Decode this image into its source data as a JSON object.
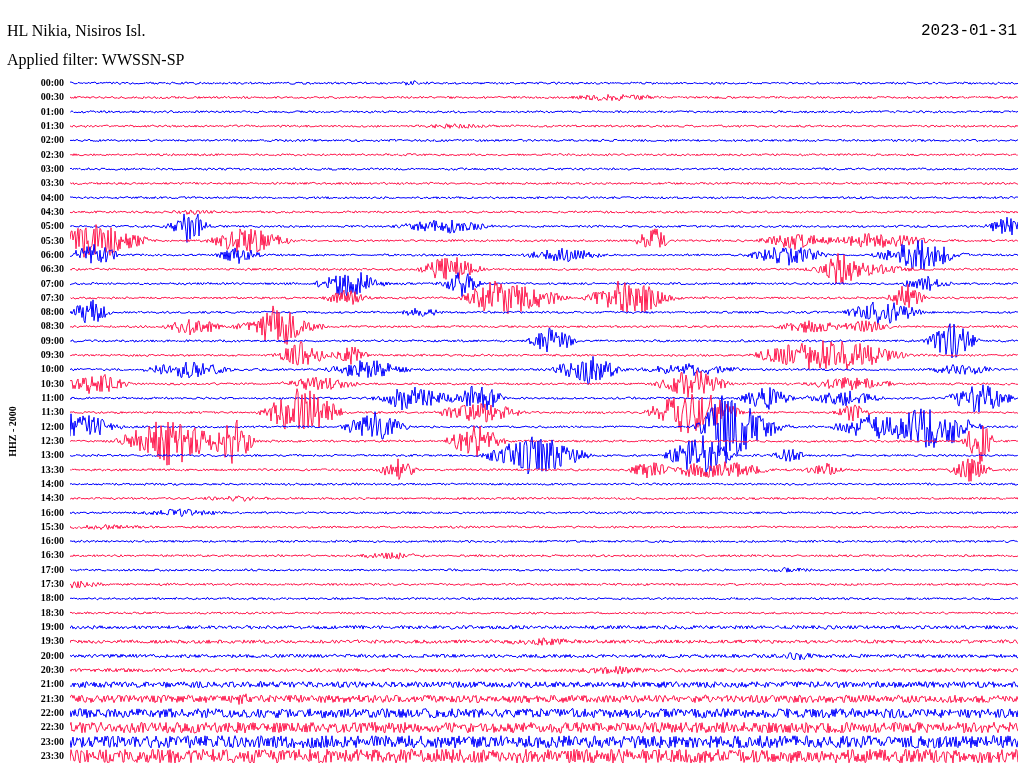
{
  "header": {
    "station": "HL Nikia, Nisiros Isl.",
    "date": "2023-01-31",
    "filter": "Applied filter: WWSSN-SP"
  },
  "axis_label": "HHZ - 2000",
  "rows": [
    {
      "time": "00:00",
      "color": "#0000ff"
    },
    {
      "time": "00:30",
      "color": "#ff1a4f"
    },
    {
      "time": "01:00",
      "color": "#0000ff"
    },
    {
      "time": "01:30",
      "color": "#ff1a4f"
    },
    {
      "time": "02:00",
      "color": "#0000ff"
    },
    {
      "time": "02:30",
      "color": "#ff1a4f"
    },
    {
      "time": "03:00",
      "color": "#0000ff"
    },
    {
      "time": "03:30",
      "color": "#ff1a4f"
    },
    {
      "time": "04:00",
      "color": "#0000ff"
    },
    {
      "time": "04:30",
      "color": "#ff1a4f"
    },
    {
      "time": "05:00",
      "color": "#0000ff"
    },
    {
      "time": "05:30",
      "color": "#ff1a4f"
    },
    {
      "time": "06:00",
      "color": "#0000ff"
    },
    {
      "time": "06:30",
      "color": "#ff1a4f"
    },
    {
      "time": "07:00",
      "color": "#0000ff"
    },
    {
      "time": "07:30",
      "color": "#ff1a4f"
    },
    {
      "time": "08:00",
      "color": "#0000ff"
    },
    {
      "time": "08:30",
      "color": "#ff1a4f"
    },
    {
      "time": "09:00",
      "color": "#0000ff"
    },
    {
      "time": "09:30",
      "color": "#ff1a4f"
    },
    {
      "time": "10:00",
      "color": "#0000ff"
    },
    {
      "time": "10:30",
      "color": "#ff1a4f"
    },
    {
      "time": "11:00",
      "color": "#0000ff"
    },
    {
      "time": "11:30",
      "color": "#ff1a4f"
    },
    {
      "time": "12:00",
      "color": "#0000ff"
    },
    {
      "time": "12:30",
      "color": "#ff1a4f"
    },
    {
      "time": "13:00",
      "color": "#0000ff"
    },
    {
      "time": "13:30",
      "color": "#ff1a4f"
    },
    {
      "time": "14:00",
      "color": "#0000ff"
    },
    {
      "time": "14:30",
      "color": "#ff1a4f"
    },
    {
      "time": "16:00",
      "color": "#0000ff"
    },
    {
      "time": "15:30",
      "color": "#ff1a4f"
    },
    {
      "time": "16:00",
      "color": "#0000ff"
    },
    {
      "time": "16:30",
      "color": "#ff1a4f"
    },
    {
      "time": "17:00",
      "color": "#0000ff"
    },
    {
      "time": "17:30",
      "color": "#ff1a4f"
    },
    {
      "time": "18:00",
      "color": "#0000ff"
    },
    {
      "time": "18:30",
      "color": "#ff1a4f"
    },
    {
      "time": "19:00",
      "color": "#0000ff"
    },
    {
      "time": "19:30",
      "color": "#ff1a4f"
    },
    {
      "time": "20:00",
      "color": "#0000ff"
    },
    {
      "time": "20:30",
      "color": "#ff1a4f"
    },
    {
      "time": "21:00",
      "color": "#0000ff"
    },
    {
      "time": "21:30",
      "color": "#ff1a4f"
    },
    {
      "time": "22:00",
      "color": "#0000ff"
    },
    {
      "time": "22:30",
      "color": "#ff1a4f"
    },
    {
      "time": "23:00",
      "color": "#0000ff"
    },
    {
      "time": "23:30",
      "color": "#ff1a4f"
    }
  ]
}
